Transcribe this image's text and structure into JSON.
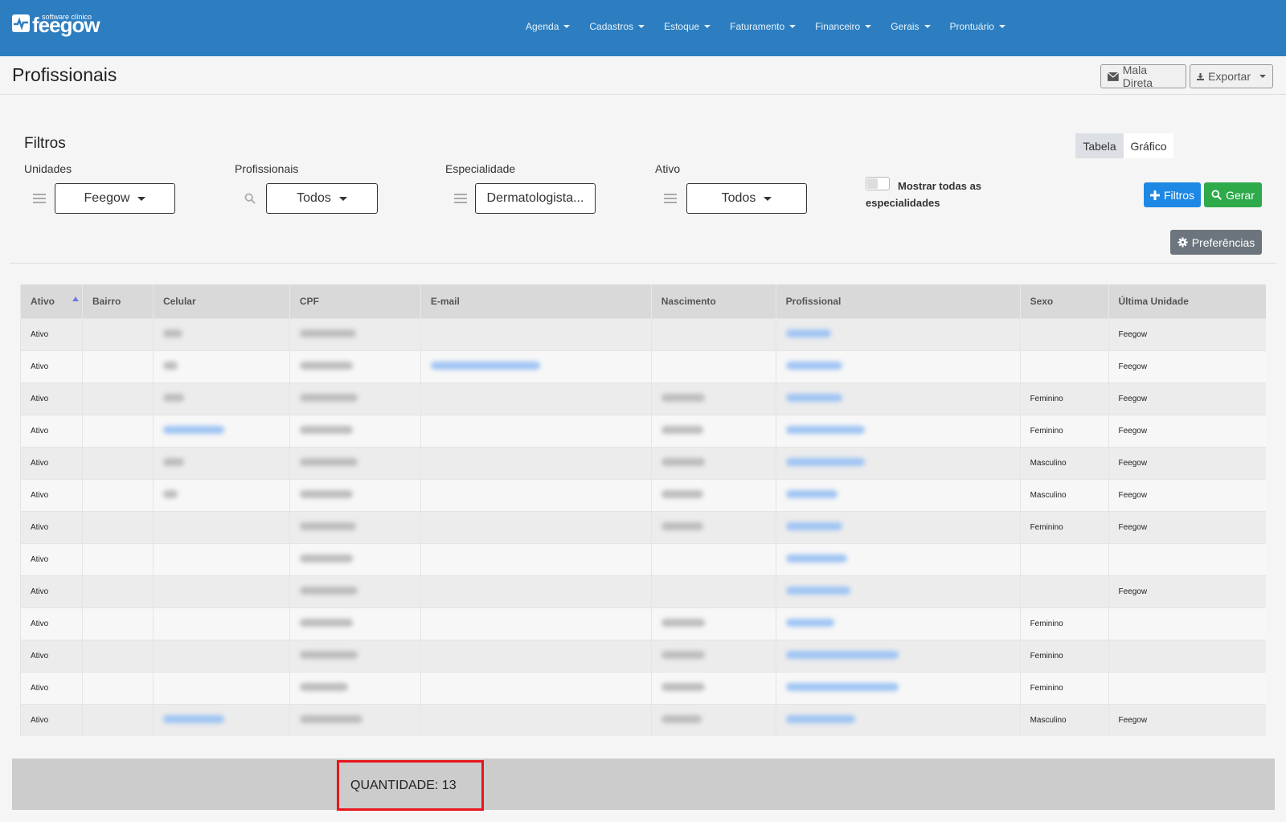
{
  "logo": {
    "text": "feegow",
    "subtitle": "software clínico"
  },
  "nav": [
    {
      "label": "Agenda"
    },
    {
      "label": "Cadastros"
    },
    {
      "label": "Estoque"
    },
    {
      "label": "Faturamento"
    },
    {
      "label": "Financeiro"
    },
    {
      "label": "Gerais"
    },
    {
      "label": "Prontuário"
    }
  ],
  "header": {
    "title": "Profissionais",
    "mail_label": "Mala Direta",
    "export_label": "Exportar"
  },
  "filters": {
    "title": "Filtros",
    "unidades": {
      "label": "Unidades",
      "value": "Feegow"
    },
    "profissionais": {
      "label": "Profissionais",
      "value": "Todos"
    },
    "especialidade": {
      "label": "Especialidade",
      "value": "Dermatologista..."
    },
    "ativo": {
      "label": "Ativo",
      "value": "Todos"
    },
    "toggle_label": "Mostrar todas as especialidades",
    "toggle_on": false
  },
  "view_toggle": {
    "tabela": "Tabela",
    "grafico": "Gráfico",
    "active": "Tabela"
  },
  "buttons": {
    "filtros": "Filtros",
    "gerar": "Gerar",
    "preferencias": "Preferências"
  },
  "table": {
    "columns": [
      "Ativo",
      "Bairro",
      "Celular",
      "CPF",
      "E-mail",
      "Nascimento",
      "Profissional",
      "Sexo",
      "Última Unidade"
    ],
    "sorted_column": "Ativo",
    "rows": [
      {
        "ativo": "Ativo",
        "sexo": "",
        "unidade": "Feegow"
      },
      {
        "ativo": "Ativo",
        "sexo": "",
        "unidade": "Feegow"
      },
      {
        "ativo": "Ativo",
        "sexo": "Feminino",
        "unidade": "Feegow"
      },
      {
        "ativo": "Ativo",
        "sexo": "Feminino",
        "unidade": "Feegow"
      },
      {
        "ativo": "Ativo",
        "sexo": "Masculino",
        "unidade": "Feegow"
      },
      {
        "ativo": "Ativo",
        "sexo": "Masculino",
        "unidade": "Feegow"
      },
      {
        "ativo": "Ativo",
        "sexo": "Feminino",
        "unidade": "Feegow"
      },
      {
        "ativo": "Ativo",
        "sexo": "",
        "unidade": ""
      },
      {
        "ativo": "Ativo",
        "sexo": "",
        "unidade": "Feegow"
      },
      {
        "ativo": "Ativo",
        "sexo": "Feminino",
        "unidade": ""
      },
      {
        "ativo": "Ativo",
        "sexo": "Feminino",
        "unidade": ""
      },
      {
        "ativo": "Ativo",
        "sexo": "Feminino",
        "unidade": ""
      },
      {
        "ativo": "Ativo",
        "sexo": "Masculino",
        "unidade": "Feegow"
      }
    ]
  },
  "footer": {
    "quantity_label": "QUANTIDADE: 13"
  },
  "colors": {
    "navbar": "#2c7ec0",
    "primary_button": "#1e88e5",
    "success_button": "#2eaa4a",
    "secondary_button": "#6c757d",
    "highlight_border": "#e8161d"
  }
}
